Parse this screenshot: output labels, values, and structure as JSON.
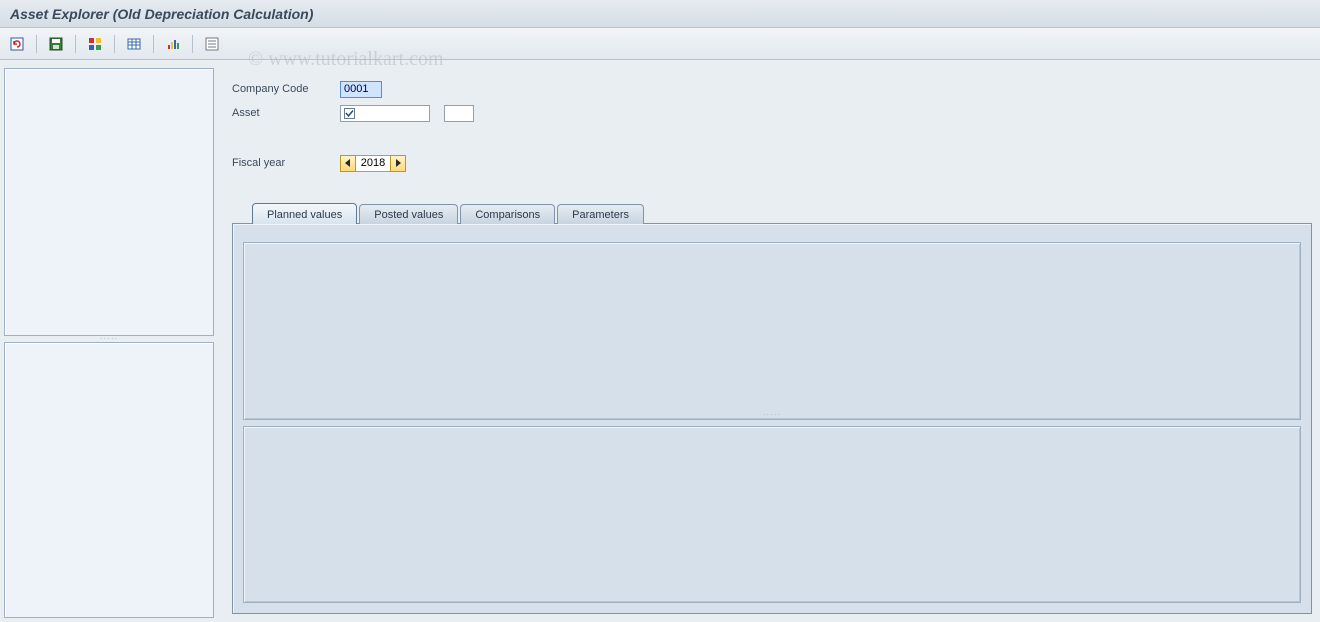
{
  "title": "Asset Explorer (Old Depreciation Calculation)",
  "watermark": "© www.tutorialkart.com",
  "form": {
    "company_code_label": "Company Code",
    "company_code_value": "0001",
    "asset_label": "Asset",
    "fiscal_year_label": "Fiscal year",
    "fiscal_year_value": "2018"
  },
  "tabs": [
    {
      "label": "Planned values"
    },
    {
      "label": "Posted values"
    },
    {
      "label": "Comparisons"
    },
    {
      "label": "Parameters"
    }
  ],
  "active_tab": 0
}
